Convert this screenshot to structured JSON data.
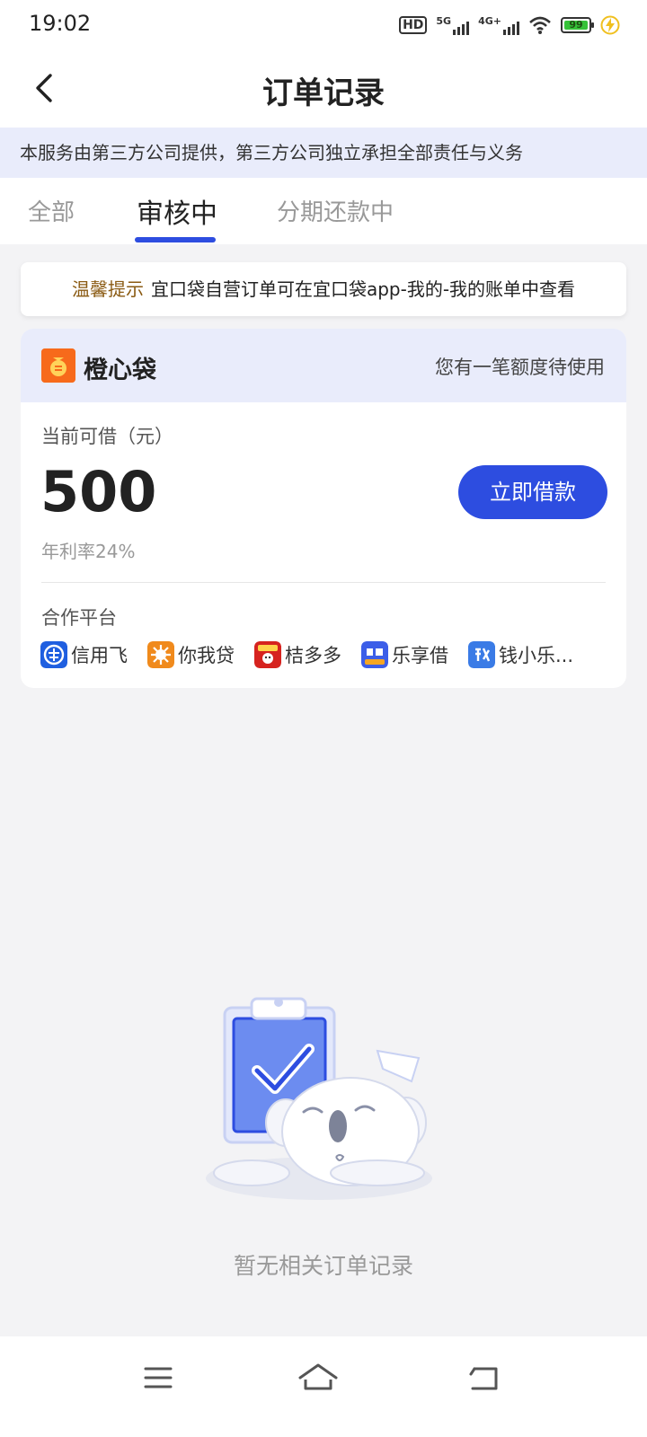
{
  "status_bar": {
    "time": "19:02",
    "hd_label": "HD",
    "net1_label": "5G",
    "net2_label": "4G+",
    "battery_level": "99"
  },
  "nav": {
    "title": "订单记录"
  },
  "disclaimer": "本服务由第三方公司提供，第三方公司独立承担全部责任与义务",
  "tabs": [
    {
      "label": "全部",
      "active": false
    },
    {
      "label": "审核中",
      "active": true
    },
    {
      "label": "分期还款中",
      "active": false
    }
  ],
  "tip": {
    "label": "温馨提示",
    "text": "宜口袋自营订单可在宜口袋app-我的-我的账单中查看"
  },
  "loan_card": {
    "brand_name": "橙心袋",
    "quota_msg": "您有一笔额度待使用",
    "limit_label": "当前可借（元）",
    "amount": "500",
    "rate": "年利率24%",
    "borrow_button": "立即借款",
    "partners_label": "合作平台",
    "partners": [
      {
        "name": "信用飞",
        "icon": "xinyongfei-logo",
        "color": "#1f5fe0"
      },
      {
        "name": "你我贷",
        "icon": "niwodai-logo",
        "color": "#f08a1c"
      },
      {
        "name": "桔多多",
        "icon": "juduoduo-logo",
        "color": "#d6231f"
      },
      {
        "name": "乐享借",
        "icon": "lexiangjie-logo",
        "color": "#3c5ee8"
      },
      {
        "name": "钱小乐...",
        "icon": "qianxiaole-logo",
        "color": "#3a7be6"
      }
    ]
  },
  "empty_state": {
    "message": "暂无相关订单记录",
    "illustration": "sleeping-koala-clipboard"
  },
  "colors": {
    "accent": "#2d4de0",
    "brand_orange": "#f76a1b",
    "tip_label": "#8a5a12"
  },
  "bottom_nav": [
    "menu-icon",
    "home-icon",
    "back-icon"
  ]
}
